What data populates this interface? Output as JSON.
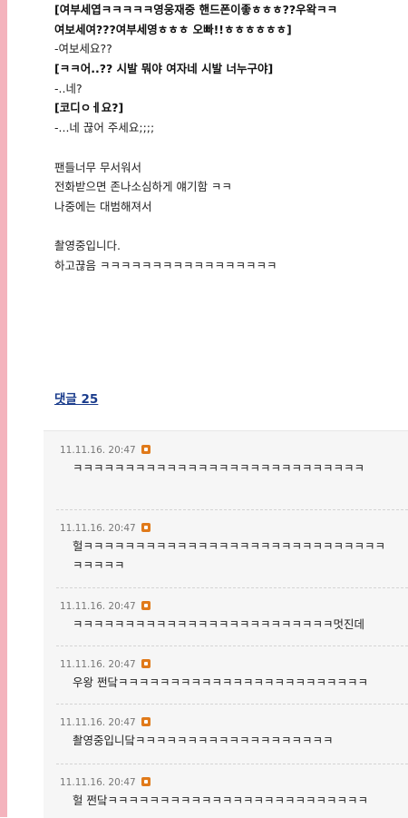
{
  "post": {
    "lines": [
      {
        "text": "[여부세엽ㅋㅋㅋㅋㅋ영웅재중 핸드폰이좋ㅎㅎㅎ??우왁ㅋㅋ",
        "bold": true
      },
      {
        "text": "여보세여???여부세영ㅎㅎㅎ 오빠!!ㅎㅎㅎㅎㅎㅎ]",
        "bold": true
      },
      {
        "text": "-여보세요??",
        "bold": false
      },
      {
        "text": "[ㅋㅋ어..?? 시발 뭐야 여자네 시발 너누구야]",
        "bold": true
      },
      {
        "text": "-..네?",
        "bold": false
      },
      {
        "text": "[코디ㅇㅔ요?]",
        "bold": true
      },
      {
        "text": "-...네 끊어 주세요;;;;",
        "bold": false
      },
      {
        "text": "",
        "bold": false
      },
      {
        "text": "팬들너무 무서워서",
        "bold": false
      },
      {
        "text": "전화받으면 존나소심하게 얘기함 ㅋㅋ",
        "bold": false
      },
      {
        "text": "나중에는 대범해져서",
        "bold": false
      },
      {
        "text": "",
        "bold": false
      },
      {
        "text": "촬영중입니다.",
        "bold": false
      },
      {
        "text": "하고끊음 ㅋㅋㅋㅋㅋㅋㅋㅋㅋㅋㅋㅋㅋㅋㅋㅋㅋ",
        "bold": false
      }
    ]
  },
  "comments_header": {
    "label": "댓글 25"
  },
  "comments": [
    {
      "time": "11.11.16. 20:47",
      "lines": [
        "ㅋㅋㅋㅋㅋㅋㅋㅋㅋㅋㅋㅋㅋㅋㅋㅋㅋㅋㅋㅋㅋㅋㅋㅋㅋㅋㅋㅋ"
      ]
    },
    {
      "time": "11.11.16. 20:47",
      "lines": [
        "헐ㅋㅋㅋㅋㅋㅋㅋㅋㅋㅋㅋㅋㅋㅋㅋㅋㅋㅋㅋㅋㅋㅋㅋㅋㅋㅋㅋㅋㅋ",
        "ㅋㅋㅋㅋㅋ"
      ]
    },
    {
      "time": "11.11.16. 20:47",
      "lines": [
        "ㅋㅋㅋㅋㅋㅋㅋㅋㅋㅋㅋㅋㅋㅋㅋㅋㅋㅋㅋㅋㅋㅋㅋㅋㅋ멋진데"
      ]
    },
    {
      "time": "11.11.16. 20:47",
      "lines": [
        "우왕 쩐닼ㅋㅋㅋㅋㅋㅋㅋㅋㅋㅋㅋㅋㅋㅋㅋㅋㅋㅋㅋㅋㅋㅋㅋㅋ"
      ]
    },
    {
      "time": "11.11.16. 20:47",
      "lines": [
        "촬영중입니닼ㅋㅋㅋㅋㅋㅋㅋㅋㅋㅋㅋㅋㅋㅋㅋㅋㅋㅋㅋ"
      ]
    },
    {
      "time": "11.11.16. 20:47",
      "lines": [
        "헐 쩐닼ㅋㅋㅋㅋㅋㅋㅋㅋㅋㅋㅋㅋㅋㅋㅋㅋㅋㅋㅋㅋㅋㅋㅋㅋㅋ"
      ]
    }
  ]
}
